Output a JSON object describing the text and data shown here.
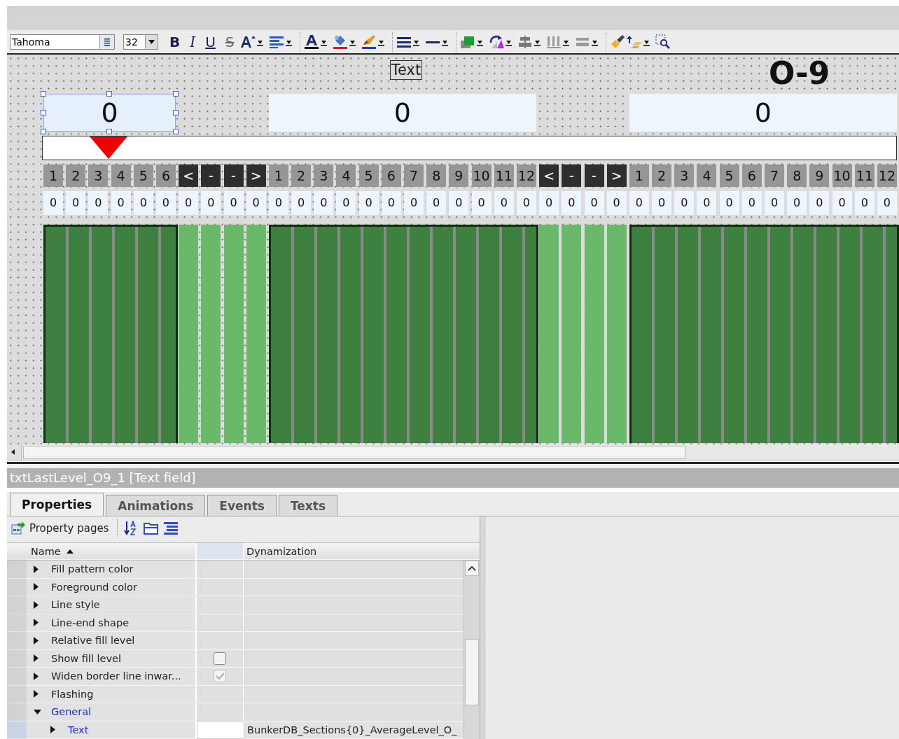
{
  "toolbar": {
    "font": "Tahoma",
    "size": "32",
    "format_buttons": [
      "B",
      "I",
      "U",
      "S"
    ]
  },
  "canvas": {
    "caption": "Text",
    "title": "O-9",
    "displays": [
      {
        "value": "0",
        "selected": true
      },
      {
        "value": "0",
        "selected": false
      },
      {
        "value": "0",
        "selected": false
      }
    ],
    "marker": {
      "level": 0.077
    },
    "columns": [
      {
        "label": "1",
        "kind": "section",
        "value": "0"
      },
      {
        "label": "2",
        "kind": "section",
        "value": "0"
      },
      {
        "label": "3",
        "kind": "section",
        "value": "0"
      },
      {
        "label": "4",
        "kind": "section",
        "value": "0"
      },
      {
        "label": "5",
        "kind": "section",
        "value": "0"
      },
      {
        "label": "6",
        "kind": "section",
        "value": "0"
      },
      {
        "label": "<",
        "kind": "control",
        "value": "0"
      },
      {
        "label": "-",
        "kind": "control",
        "value": "0"
      },
      {
        "label": "-",
        "kind": "control",
        "value": "0"
      },
      {
        "label": ">",
        "kind": "control",
        "value": "0"
      },
      {
        "label": "1",
        "kind": "section",
        "value": "0"
      },
      {
        "label": "2",
        "kind": "section",
        "value": "0"
      },
      {
        "label": "3",
        "kind": "section",
        "value": "0"
      },
      {
        "label": "4",
        "kind": "section",
        "value": "0"
      },
      {
        "label": "5",
        "kind": "section",
        "value": "0"
      },
      {
        "label": "6",
        "kind": "section",
        "value": "0"
      },
      {
        "label": "7",
        "kind": "section",
        "value": "0"
      },
      {
        "label": "8",
        "kind": "section",
        "value": "0"
      },
      {
        "label": "9",
        "kind": "section",
        "value": "0"
      },
      {
        "label": "10",
        "kind": "section",
        "value": "0"
      },
      {
        "label": "11",
        "kind": "section",
        "value": "0"
      },
      {
        "label": "12",
        "kind": "section",
        "value": "0"
      },
      {
        "label": "<",
        "kind": "control",
        "value": "0"
      },
      {
        "label": "-",
        "kind": "control",
        "value": "0"
      },
      {
        "label": "-",
        "kind": "control",
        "value": "0"
      },
      {
        "label": ">",
        "kind": "control",
        "value": "0"
      },
      {
        "label": "1",
        "kind": "section",
        "value": "0"
      },
      {
        "label": "2",
        "kind": "section",
        "value": "0"
      },
      {
        "label": "3",
        "kind": "section",
        "value": "0"
      },
      {
        "label": "4",
        "kind": "section",
        "value": "0"
      },
      {
        "label": "5",
        "kind": "section",
        "value": "0"
      },
      {
        "label": "6",
        "kind": "section",
        "value": "0"
      },
      {
        "label": "7",
        "kind": "section",
        "value": "0"
      },
      {
        "label": "8",
        "kind": "section",
        "value": "0"
      },
      {
        "label": "9",
        "kind": "section",
        "value": "0"
      },
      {
        "label": "10",
        "kind": "section",
        "value": "0"
      },
      {
        "label": "11",
        "kind": "section",
        "value": "0"
      },
      {
        "label": "12",
        "kind": "section",
        "value": "0"
      }
    ]
  },
  "selection": {
    "title": "txtLastLevel_O9_1 [Text field]"
  },
  "tabs": [
    {
      "label": "Properties",
      "selected": true
    },
    {
      "label": "Animations",
      "selected": false
    },
    {
      "label": "Events",
      "selected": false
    },
    {
      "label": "Texts",
      "selected": false
    }
  ],
  "properties_toolbar": {
    "label": "Property pages"
  },
  "table": {
    "columns": [
      {
        "label": "Name",
        "sort_ascending": true
      },
      {
        "label": "Dynamization"
      }
    ],
    "rows": [
      {
        "children": [
          {
            "name": "Fill pattern color",
            "expanded": false
          },
          {
            "name": "Foreground color",
            "expanded": false
          },
          {
            "name": "Line style",
            "expanded": false
          },
          {
            "name": "Line-end shape",
            "expanded": false
          },
          {
            "name": "Relative fill level",
            "expanded": false
          },
          {
            "name": "Show fill level",
            "expanded": false,
            "checked": false
          },
          {
            "name": "Widen border line inwar...",
            "expanded": false,
            "checked": true
          }
        ]
      },
      {
        "name": "Flashing",
        "expanded": false,
        "modified": false
      },
      {
        "name": "General",
        "expanded": true,
        "modified": true,
        "children": [
          {
            "name": "Text",
            "expanded": false,
            "modified": true,
            "dynamization": "BunkerDB_Sections{0}_AverageLevel_O_"
          }
        ]
      }
    ]
  }
}
